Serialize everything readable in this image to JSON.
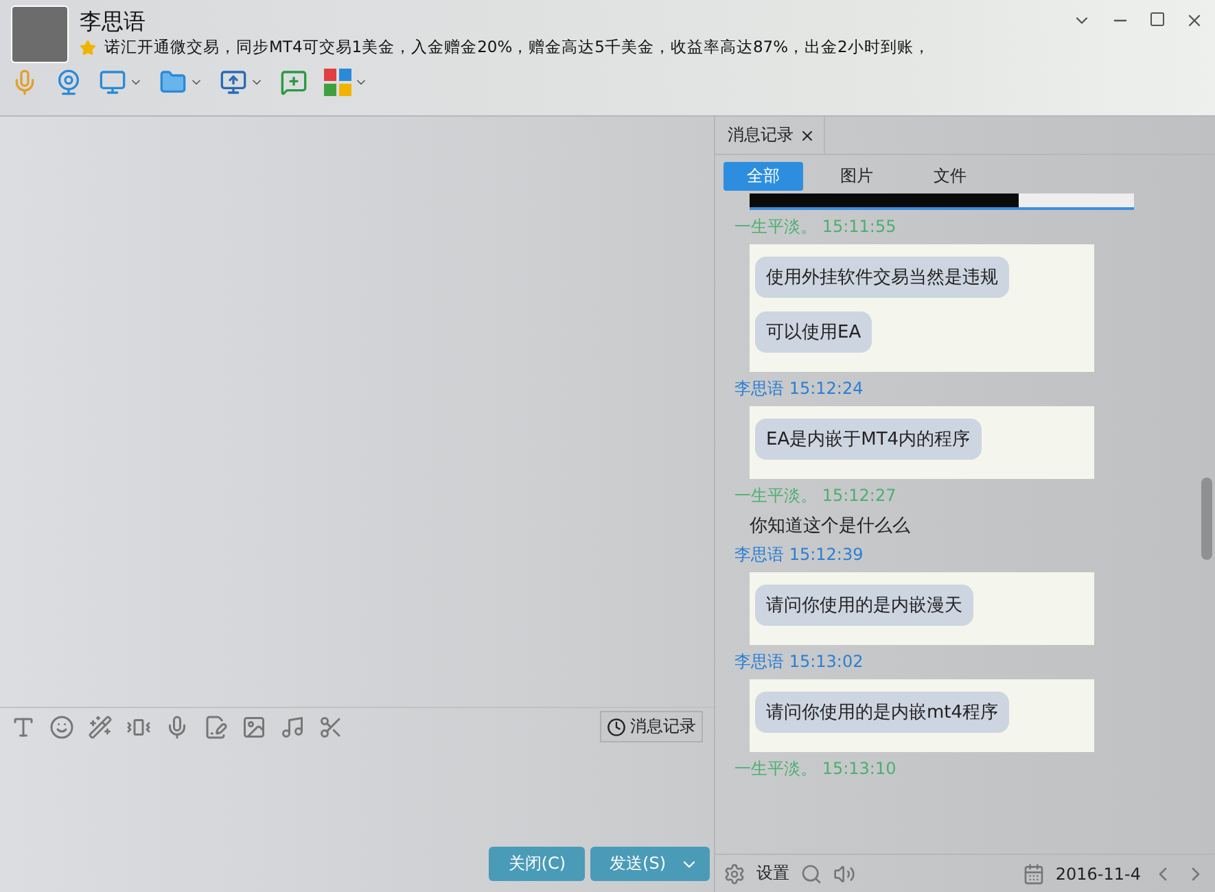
{
  "contact": {
    "name": "李思语",
    "signature": "诺汇开通微交易，同步MT4可交易1美金，入金赠金20%，赠金高达5千美金，收益率高达87%，出金2小时到账，"
  },
  "history_button": "消息记录",
  "buttons": [
    {
      "label": "关闭(C)",
      "kind": "plain"
    },
    {
      "label": "发送(S)",
      "kind": "split"
    }
  ],
  "history": {
    "tab": "消息记录",
    "filters": [
      {
        "label": "全部",
        "selected": true
      },
      {
        "label": "图片",
        "selected": false
      },
      {
        "label": "文件",
        "selected": false
      }
    ],
    "messages": [
      {
        "sender": "一生平淡。",
        "time": "15:11:55",
        "color": "#4caf6e",
        "kind": "card",
        "bubbles": [
          "使用外挂软件交易当然是违规",
          "可以使用EA"
        ]
      },
      {
        "sender": "李思语",
        "time": "15:12:24",
        "color": "#2a7fd4",
        "kind": "card",
        "bubbles": [
          "EA是内嵌于MT4内的程序"
        ]
      },
      {
        "sender": "一生平淡。",
        "time": "15:12:27",
        "color": "#4caf6e",
        "kind": "plain",
        "bubbles": [
          "你知道这个是什么么"
        ]
      },
      {
        "sender": "李思语",
        "time": "15:12:39",
        "color": "#2a7fd4",
        "kind": "card",
        "bubbles": [
          "请问你使用的是内嵌漫天"
        ]
      },
      {
        "sender": "李思语",
        "time": "15:13:02",
        "color": "#2a7fd4",
        "kind": "card",
        "bubbles": [
          "请问你使用的是内嵌mt4程序"
        ]
      },
      {
        "sender": "一生平淡。",
        "time": "15:13:10",
        "color": "#4caf6e"
      }
    ],
    "settings": "设置",
    "date": "2016-11-4"
  }
}
